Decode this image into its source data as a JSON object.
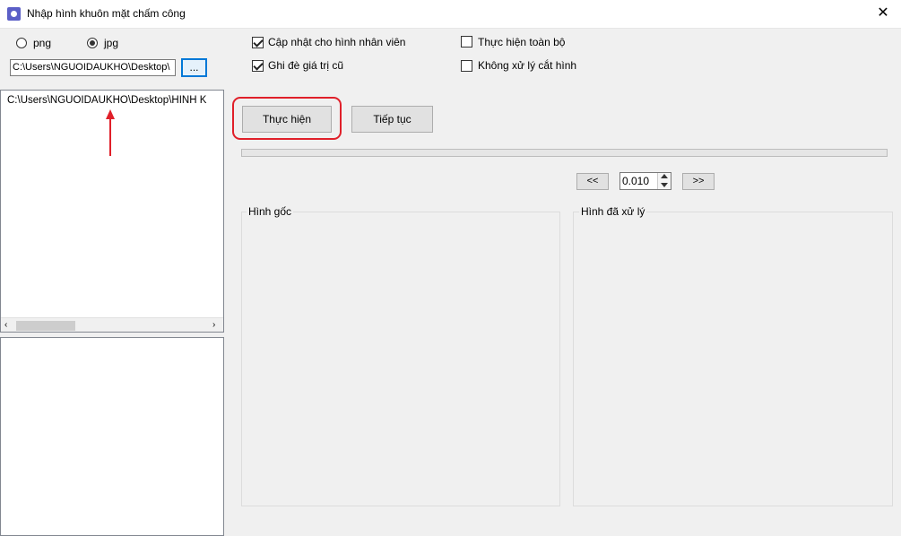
{
  "window": {
    "title": "Nhập hình khuôn mặt chấm công",
    "close_glyph": "✕"
  },
  "format": {
    "png_label": "png",
    "jpg_label": "jpg",
    "selected": "jpg"
  },
  "options": {
    "update_photo_label": "Cập nhật cho hình nhân viên",
    "update_photo_checked": true,
    "overwrite_label": "Ghi đè giá trị cũ",
    "overwrite_checked": true,
    "run_all_label": "Thực hiện toàn bộ",
    "run_all_checked": false,
    "no_crop_label": "Không xử lý cắt hình",
    "no_crop_checked": false
  },
  "path": {
    "value": "C:\\Users\\NGUOIDAUKHO\\Desktop\\",
    "browse_label": "..."
  },
  "file_list": {
    "items": [
      "C:\\Users\\NGUOIDAUKHO\\Desktop\\HINH K"
    ]
  },
  "actions": {
    "run_label": "Thực hiện",
    "continue_label": "Tiếp tục"
  },
  "progress": {
    "value": 0
  },
  "stepper": {
    "prev_label": "<<",
    "next_label": ">>",
    "value": "0.010"
  },
  "panels": {
    "original_title": "Hình gốc",
    "processed_title": "Hình đã xử lý"
  },
  "annotation": {
    "highlight_color": "#e0202a",
    "arrow_color": "#e0202a"
  }
}
